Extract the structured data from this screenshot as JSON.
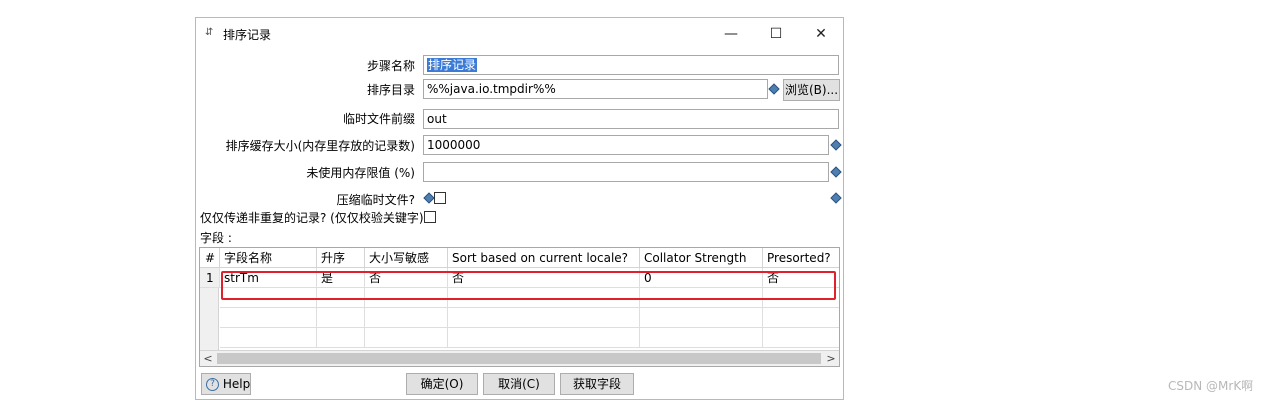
{
  "window": {
    "title": "排序记录",
    "controls": {
      "minimize": "—",
      "maximize": "☐",
      "close": "✕"
    }
  },
  "form": {
    "step_name": {
      "label": "步骤名称",
      "value": "排序记录"
    },
    "sort_dir": {
      "label": "排序目录",
      "value": "%%java.io.tmpdir%%",
      "browse_label": "浏览(B)..."
    },
    "temp_prefix": {
      "label": "临时文件前缀",
      "value": "out"
    },
    "sort_size": {
      "label": "排序缓存大小(内存里存放的记录数)",
      "value": "1000000"
    },
    "free_memory": {
      "label": "未使用内存限值 (%)",
      "value": ""
    },
    "compress": {
      "label": "压缩临时文件?",
      "checked": false
    },
    "unique_only": {
      "label": "仅仅传递非重复的记录? (仅仅校验关键字)",
      "checked": false
    },
    "fields_label": "字段 :"
  },
  "table": {
    "columns": [
      "#",
      "字段名称",
      "升序",
      "大小写敏感",
      "Sort based on current locale?",
      "Collator Strength",
      "Presorted?"
    ],
    "rows": [
      [
        "1",
        "strTm",
        "是",
        "否",
        "否",
        "0",
        "否"
      ]
    ],
    "scroll_left": "<",
    "scroll_right": ">"
  },
  "buttons": {
    "help": "Help",
    "ok": "确定(O)",
    "cancel": "取消(C)",
    "get_fields": "获取字段"
  },
  "watermark": "CSDN @MrK啊",
  "colors": {
    "highlight": "#e0202a",
    "selection": "#3b7bd6"
  }
}
